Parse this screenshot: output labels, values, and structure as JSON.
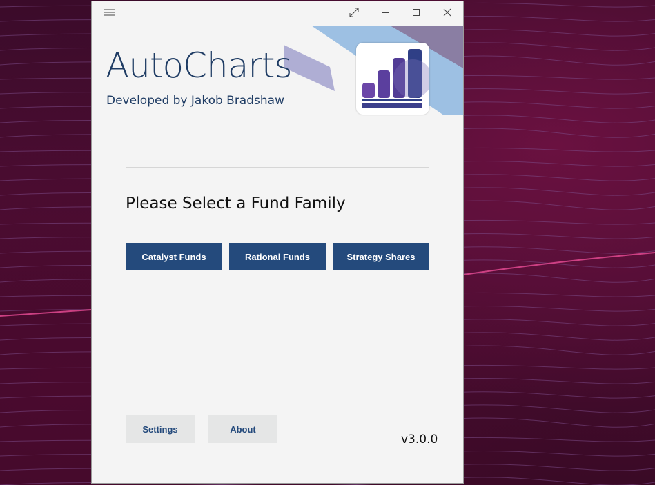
{
  "app": {
    "title": "AutoCharts",
    "subtitle": "Developed by Jakob Bradshaw",
    "version": "v3.0.0"
  },
  "titlebar": {
    "menu_icon": "hamburger-icon",
    "fullscreen_icon": "expand-diagonal-icon",
    "minimize_icon": "minimize-icon",
    "maximize_icon": "maximize-icon",
    "close_icon": "close-icon"
  },
  "main": {
    "prompt": "Please Select a Fund Family",
    "fund_buttons": [
      {
        "label": "Catalyst Funds"
      },
      {
        "label": "Rational Funds"
      },
      {
        "label": "Strategy Shares"
      }
    ]
  },
  "footer": {
    "settings_label": "Settings",
    "about_label": "About"
  },
  "colors": {
    "brand_navy": "#244a7c",
    "title_text": "#1f3c64",
    "secondary_button": "#e5e6e6",
    "window_bg": "#f4f4f4",
    "desktop_bg": "#3b0b2a"
  }
}
